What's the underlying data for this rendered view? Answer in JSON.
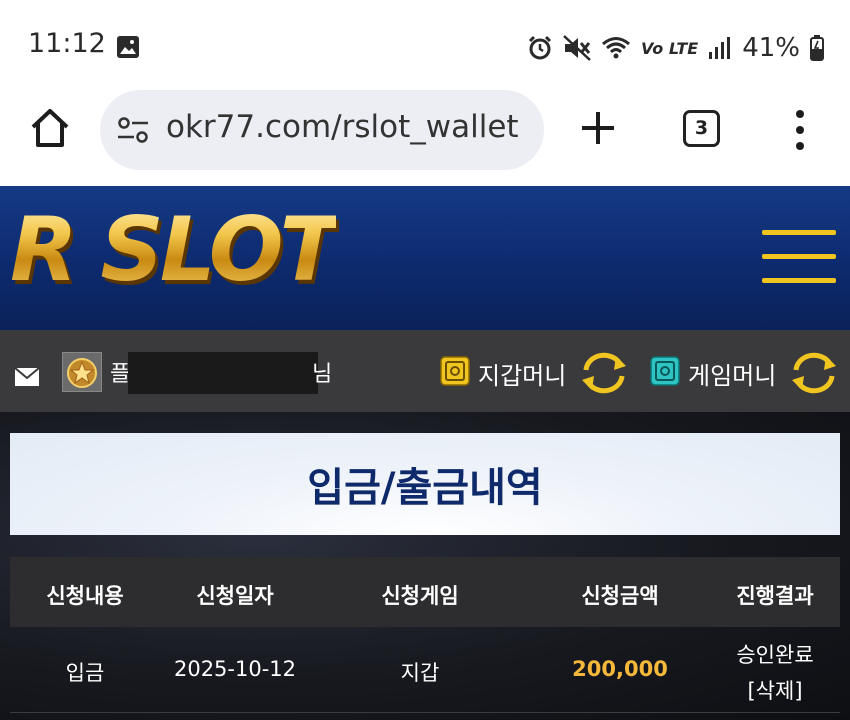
{
  "status_bar": {
    "time": "11:12",
    "battery": "41%",
    "network": "Vo LTE",
    "icons": [
      "image-icon",
      "alarm-icon",
      "mute-icon",
      "wifi-icon",
      "signal-icon",
      "battery-icon"
    ]
  },
  "browser": {
    "url": "okr77.com/rslot_wallet",
    "tab_count": "3"
  },
  "site": {
    "logo": "R SLOT",
    "accent_color": "#f1c520",
    "header_color": "#0d2a6e"
  },
  "user_bar": {
    "username_start": "플",
    "username_end": "님",
    "wallet_label": "지갑머니",
    "game_label": "게임머니"
  },
  "page": {
    "title": "입금/출금내역"
  },
  "table": {
    "headers": [
      "신청내용",
      "신청일자",
      "신청게임",
      "신청금액",
      "진행결과"
    ],
    "rows": [
      {
        "type": "입금",
        "date": "2025-10-12",
        "game": "지갑",
        "amount": "200,000",
        "status": "승인완료",
        "action": "[삭제]"
      }
    ]
  }
}
